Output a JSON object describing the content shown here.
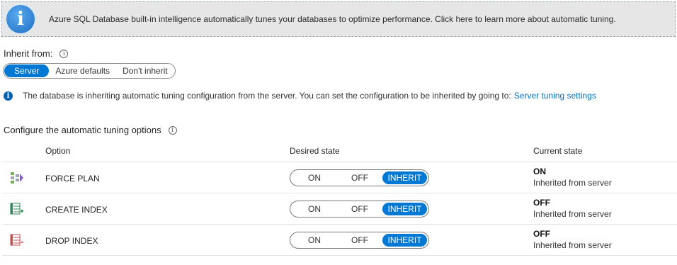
{
  "banner": {
    "icon": "info-icon",
    "text": "Azure SQL Database built-in intelligence automatically tunes your databases to optimize performance. Click here to learn more about automatic tuning."
  },
  "inherit": {
    "label": "Inherit from:",
    "options": [
      "Server",
      "Azure defaults",
      "Don't inherit"
    ],
    "selected": "Server"
  },
  "info": {
    "text": "The database is inheriting automatic tuning configuration from the server. You can set the configuration to be inherited by going to:",
    "link": "Server tuning settings"
  },
  "configure": {
    "label": "Configure the automatic tuning options"
  },
  "table": {
    "headers": {
      "option": "Option",
      "desired": "Desired state",
      "current": "Current state"
    },
    "rows": [
      {
        "icon": "force-plan-icon",
        "name": "FORCE PLAN",
        "toggle": [
          "ON",
          "OFF",
          "INHERIT"
        ],
        "selected": "INHERIT",
        "current": "ON",
        "current_sub": "Inherited from server"
      },
      {
        "icon": "create-index-icon",
        "name": "CREATE INDEX",
        "toggle": [
          "ON",
          "OFF",
          "INHERIT"
        ],
        "selected": "INHERIT",
        "current": "OFF",
        "current_sub": "Inherited from server"
      },
      {
        "icon": "drop-index-icon",
        "name": "DROP INDEX",
        "toggle": [
          "ON",
          "OFF",
          "INHERIT"
        ],
        "selected": "INHERIT",
        "current": "OFF",
        "current_sub": "Inherited from server"
      }
    ]
  },
  "colors": {
    "accent": "#0078d4",
    "link": "#0072c6",
    "banner_bg": "#e6e6e6"
  }
}
